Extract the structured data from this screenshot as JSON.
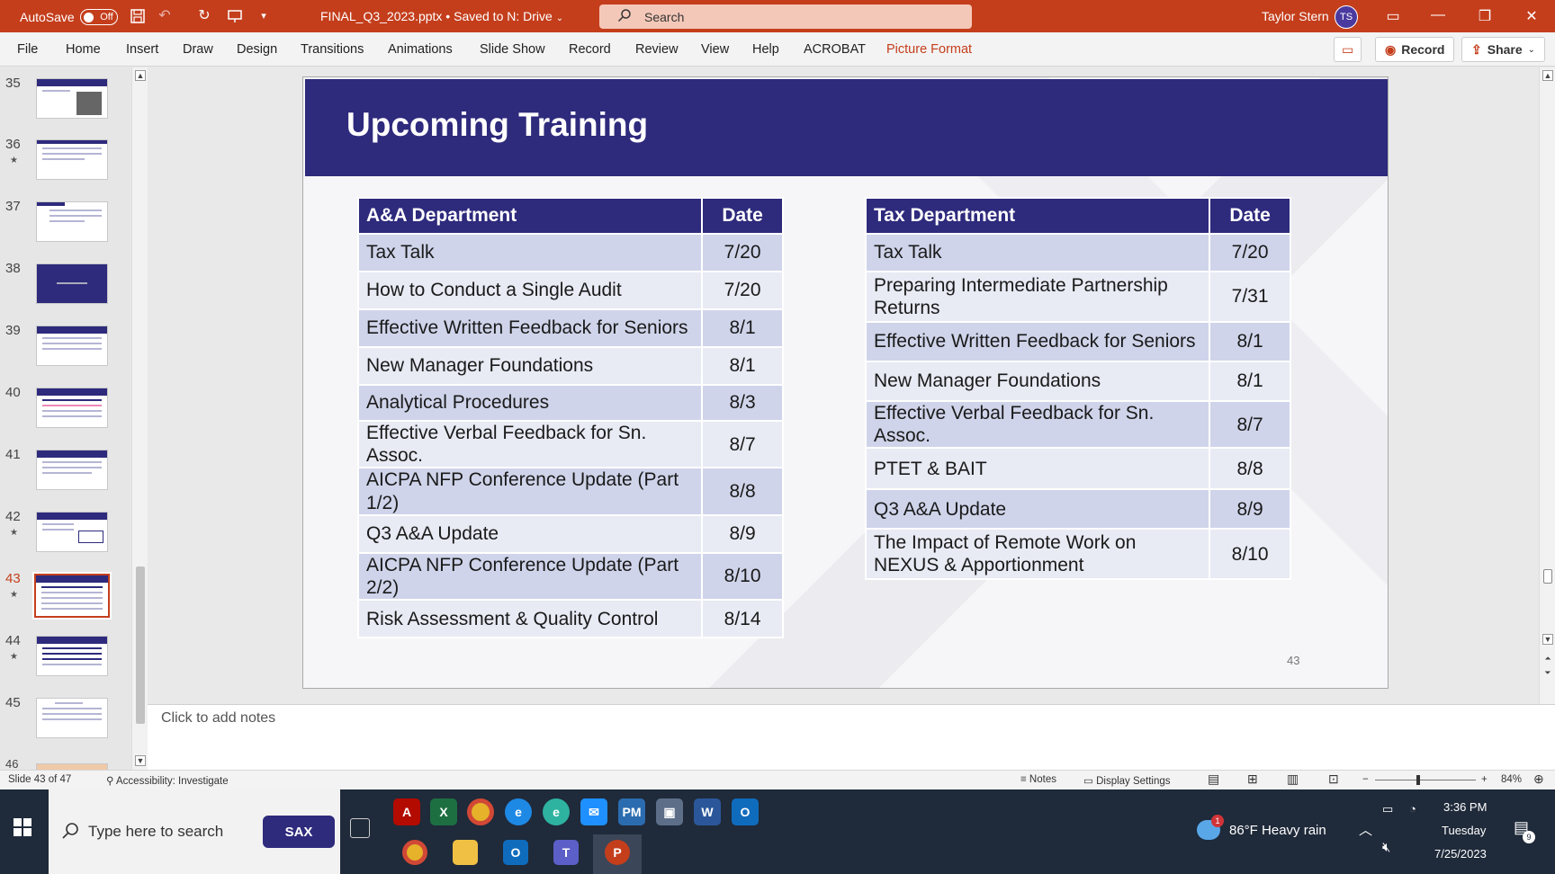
{
  "titlebar": {
    "autosave_label": "AutoSave",
    "autosave_state": "Off",
    "filename": "FINAL_Q3_2023.pptx • Saved to N: Drive",
    "search_placeholder": "Search",
    "user_name": "Taylor Stern",
    "user_initials": "TS"
  },
  "ribbon": {
    "tabs": [
      "File",
      "Home",
      "Insert",
      "Draw",
      "Design",
      "Transitions",
      "Animations",
      "Slide Show",
      "Record",
      "Review",
      "View",
      "Help",
      "ACROBAT",
      "Picture Format"
    ],
    "active_tab": "Picture Format",
    "record_label": "Record",
    "share_label": "Share"
  },
  "thumbnails": [
    {
      "num": "35",
      "star": false
    },
    {
      "num": "36",
      "star": true
    },
    {
      "num": "37",
      "star": false
    },
    {
      "num": "38",
      "star": false
    },
    {
      "num": "39",
      "star": false
    },
    {
      "num": "40",
      "star": false
    },
    {
      "num": "41",
      "star": false
    },
    {
      "num": "42",
      "star": true
    },
    {
      "num": "43",
      "star": true
    },
    {
      "num": "44",
      "star": true
    },
    {
      "num": "45",
      "star": false
    },
    {
      "num": "46",
      "star": false
    }
  ],
  "slide": {
    "title": "Upcoming Training",
    "page_number": "43",
    "aa_table": {
      "headers": [
        "A&A Department",
        "Date"
      ],
      "rows": [
        [
          "Tax Talk",
          "7/20"
        ],
        [
          "How to Conduct a Single Audit",
          "7/20"
        ],
        [
          "Effective Written Feedback for Seniors",
          "8/1"
        ],
        [
          "New Manager Foundations",
          "8/1"
        ],
        [
          "Analytical Procedures",
          "8/3"
        ],
        [
          "Effective Verbal Feedback for Sn. Assoc.",
          "8/7"
        ],
        [
          "AICPA NFP Conference Update (Part 1/2)",
          "8/8"
        ],
        [
          "Q3 A&A Update",
          "8/9"
        ],
        [
          "AICPA NFP Conference Update (Part 2/2)",
          "8/10"
        ],
        [
          "Risk Assessment & Quality Control",
          "8/14"
        ]
      ]
    },
    "tax_table": {
      "headers": [
        "Tax Department",
        "Date"
      ],
      "rows": [
        [
          "Tax Talk",
          "7/20"
        ],
        [
          "Preparing Intermediate Partnership Returns",
          "7/31"
        ],
        [
          "Effective Written Feedback for Seniors",
          "8/1"
        ],
        [
          "New Manager Foundations",
          "8/1"
        ],
        [
          "Effective Verbal Feedback for Sn. Assoc.",
          "8/7"
        ],
        [
          "PTET & BAIT",
          "8/8"
        ],
        [
          "Q3 A&A Update",
          "8/9"
        ],
        [
          "The Impact of Remote Work on NEXUS & Apportionment",
          "8/10"
        ]
      ]
    }
  },
  "notes_placeholder": "Click to add notes",
  "statusbar": {
    "slide_info": "Slide 43 of 47",
    "accessibility": "Accessibility: Investigate",
    "notes": "Notes",
    "display_settings": "Display Settings",
    "zoom": "84%"
  },
  "taskbar": {
    "search_placeholder": "Type here to search",
    "sax_label": "SAX",
    "weather": "86°F  Heavy rain",
    "time": "3:36 PM",
    "day": "Tuesday",
    "date": "7/25/2023",
    "notification_count": "9",
    "weather_badge": "1"
  },
  "colors": {
    "accent": "#c43e1c",
    "slide_navy": "#2e2a7c",
    "row_dark": "#cfd4ea",
    "row_light": "#e8eaf4"
  }
}
